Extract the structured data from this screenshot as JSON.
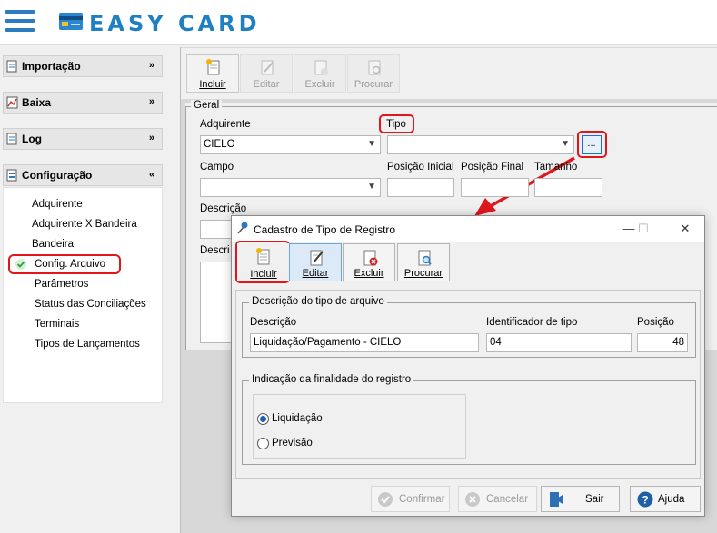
{
  "app": {
    "brand": "EASY CARD",
    "brand_color": "#1e7fc2"
  },
  "sidebar": {
    "sections": [
      {
        "label": "Importação",
        "icon": "document-icon",
        "expanded": false
      },
      {
        "label": "Baixa",
        "icon": "chart-icon",
        "expanded": false
      },
      {
        "label": "Log",
        "icon": "document-icon",
        "expanded": false
      },
      {
        "label": "Configuração",
        "icon": "config-icon",
        "expanded": true
      }
    ],
    "config_items": [
      "Adquirente",
      "Adquirente X Bandeira",
      "Bandeira",
      "Config. Arquivo",
      "Parâmetros",
      "Status das Conciliações",
      "Terminais",
      "Tipos de Lançamentos"
    ],
    "selected_item": "Config. Arquivo"
  },
  "main": {
    "toolbar": {
      "incluir": "Incluir",
      "editar": "Editar",
      "excluir": "Excluir",
      "procurar": "Procurar"
    },
    "group_title": "Geral",
    "fields": {
      "adquirente_label": "Adquirente",
      "adquirente_value": "CIELO",
      "tipo_label": "Tipo",
      "tipo_value": "",
      "lookup_button": "...",
      "campo_label": "Campo",
      "campo_value": "",
      "posicao_inicial_label": "Posição Inicial",
      "posicao_final_label": "Posição Final",
      "tamanho_label": "Tamanho",
      "descricao_label": "Descrição",
      "descri_label_partial": "Descri"
    }
  },
  "dialog": {
    "title": "Cadastro de Tipo de Registro",
    "toolbar": {
      "incluir": "Incluir",
      "editar": "Editar",
      "excluir": "Excluir",
      "procurar": "Procurar"
    },
    "group1_title": "Descrição do tipo de arquivo",
    "descricao_label": "Descrição",
    "descricao_value": "Liquidação/Pagamento - CIELO",
    "identificador_label": "Identificador de tipo",
    "identificador_value": "04",
    "posicao_label": "Posição",
    "posicao_value": "48",
    "group2_title": "Indicação da finalidade do registro",
    "radio_options": [
      "Liquidação",
      "Previsão"
    ],
    "radio_selected": "Liquidação",
    "footer": {
      "confirmar": "Confirmar",
      "cancelar": "Cancelar",
      "sair": "Sair",
      "ajuda": "Ajuda"
    }
  },
  "annotation_color": "#e0161d"
}
